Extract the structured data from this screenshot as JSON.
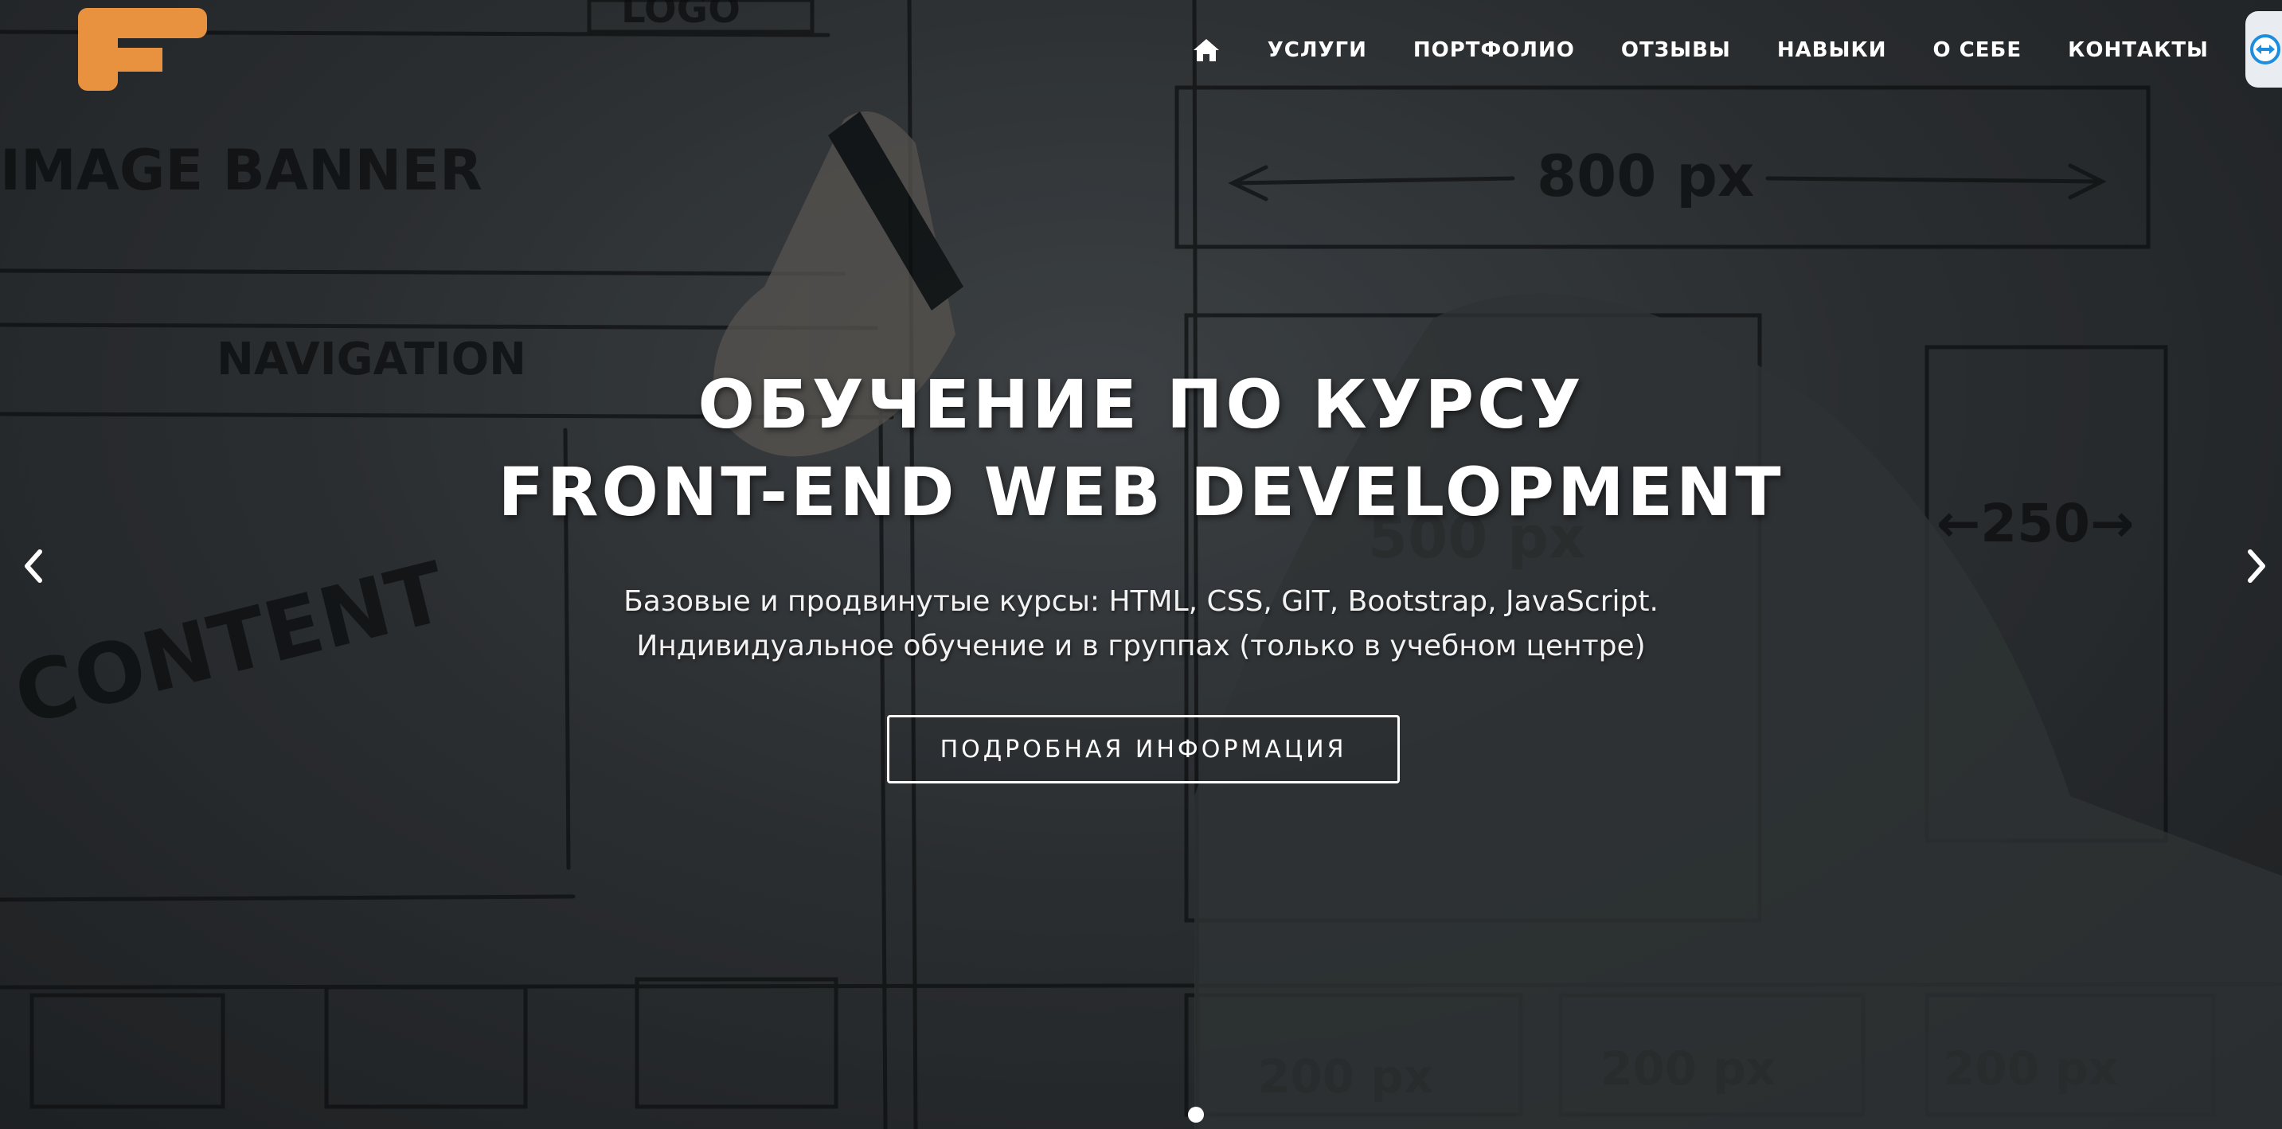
{
  "nav": {
    "home_icon": "home-icon",
    "items": [
      {
        "label": "УСЛУГИ"
      },
      {
        "label": "ПОРТФОЛИО"
      },
      {
        "label": "ОТЗЫВЫ"
      },
      {
        "label": "НАВЫКИ"
      },
      {
        "label": "О СЕБЕ"
      },
      {
        "label": "КОНТАКТЫ"
      }
    ]
  },
  "hero": {
    "title_line1": "ОБУЧЕНИЕ ПО КУРСУ",
    "title_line2": "FRONT-END WEB DEVELOPMENT",
    "subtitle_line1": "Базовые и продвинутые курсы: HTML, CSS, GIT, Bootstrap, JavaScript.",
    "subtitle_line2": "Индивидуальное обучение и в группах (только в учебном центре)",
    "cta_label": "ПОДРОБНАЯ ИНФОРМАЦИЯ",
    "background_sketch_text": [
      "LOGO",
      "IMAGE BANNER",
      "NAVIGATION",
      "CONTENT",
      "800 px",
      "500 px",
      "250",
      "200 px"
    ]
  },
  "carousel": {
    "prev_icon": "chevron-left-icon",
    "next_icon": "chevron-right-icon",
    "slide_count": 1,
    "active_slide": 1
  },
  "colors": {
    "logo_orange": "#e8913e",
    "text": "#ffffff",
    "side_tab": "#e9edf2",
    "side_tab_icon": "#1d8ede"
  }
}
